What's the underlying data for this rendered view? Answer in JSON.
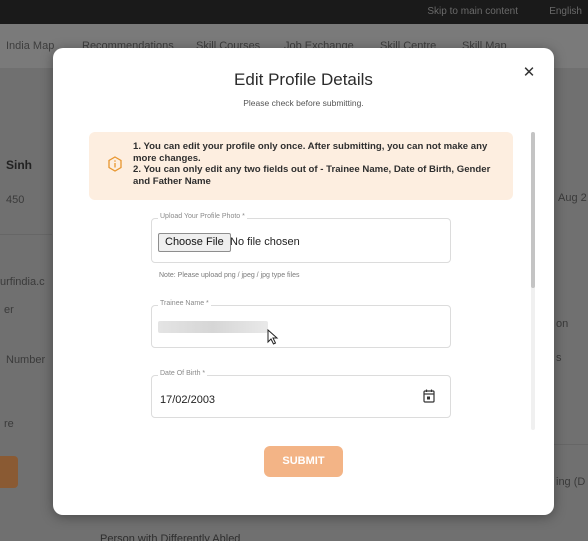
{
  "background": {
    "skip_link": "Skip to main content",
    "language": "English",
    "nav": [
      "India Map",
      "Recommendations",
      "Skill Courses",
      "Job Exchange",
      "Skill Centre",
      "Skill Map"
    ],
    "left_fragments": [
      "Sinh",
      "450",
      "urfindia.c",
      "er",
      "Number",
      "re"
    ],
    "right_fragments": [
      "Aug 2",
      "on",
      "s",
      "ing (D"
    ],
    "bottom_fragment": "Person with Differently Abled"
  },
  "modal": {
    "title": "Edit Profile Details",
    "subtitle": "Please check before submitting.",
    "close_icon": "close-icon",
    "notice": {
      "icon": "info-hexagon-icon",
      "lines": [
        "1. You can edit your profile only once. After submitting, you can not make any more changes.",
        "2. You can only edit any two fields out of - Trainee Name, Date of Birth, Gender and Father Name"
      ]
    },
    "photo": {
      "label": "Upload Your Profile Photo *",
      "button": "Choose File",
      "status": "No file chosen",
      "note": "Note: Please upload png / jpeg / jpg type files"
    },
    "trainee_name": {
      "label": "Trainee Name *",
      "value": ""
    },
    "dob": {
      "label": "Date Of Birth *",
      "value": "17/02/2003",
      "icon": "calendar-icon"
    },
    "submit_label": "SUBMIT"
  },
  "colors": {
    "accent": "#f3b486",
    "notice_bg": "#fdeee0",
    "notice_icon": "#e8962f"
  }
}
